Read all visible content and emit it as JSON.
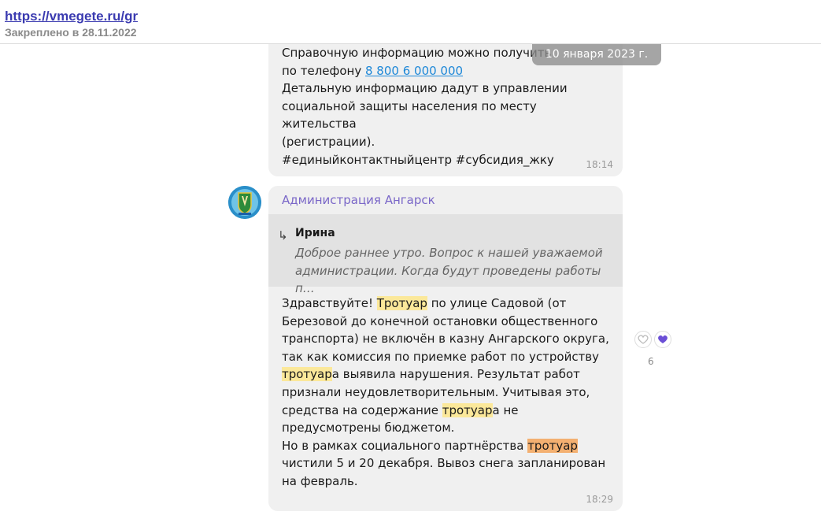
{
  "pinned": {
    "link": "https://vmegete.ru/gr",
    "date": "Закреплено в 28.11.2022"
  },
  "date_pill": "10 января 2023 г.",
  "message1": {
    "lines": [
      "Справочную информацию можно получить",
      " по телефону ",
      "8 800 6 000 000",
      "Детальную информацию дадут в управлении",
      "социальной защиты населения по месту жительства",
      "(регистрации).",
      "#единыйконтактныйцентр #субсидия_жку"
    ],
    "time": "18:14"
  },
  "message2": {
    "sender": "Администрация Ангарск",
    "reply": {
      "author": "Ирина",
      "preview": "Доброе раннее утро. Вопрос к нашей уважаемой администрации. Когда будут проведены работы п…"
    },
    "segments": [
      "Здравствуйте! ",
      "Тротуар",
      " по улице Садовой (от Березовой до конечной остановки общественного транспорта) не включён в казну Ангарского округа, так как комиссия по приемке работ по устройству ",
      "тротуар",
      "а выявила нарушения. Результат работ признали неудовлетворительным. Учитывая это, средства на содержание ",
      "тротуар",
      "а не предусмотрены бюджетом.",
      "Но в рамках социального партнёрства ",
      "тротуар",
      " чистили 5 и 20 декабря. Вывоз снега запланирован на февраль."
    ],
    "time": "18:29",
    "reactions_count": "6"
  },
  "colors": {
    "highlight": "#fbe89a",
    "highlight_active": "#f3b071",
    "sender": "#7a67c8",
    "link": "#1e88d8"
  }
}
